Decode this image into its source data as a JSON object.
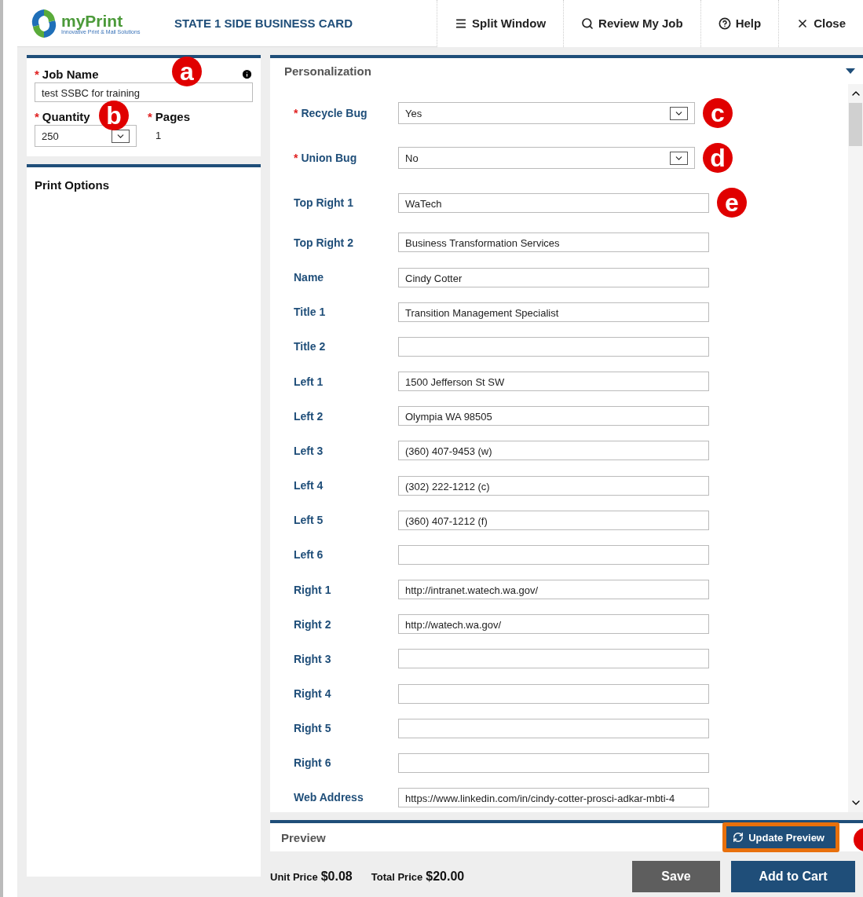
{
  "header": {
    "logo_text": "myPrint",
    "logo_tagline": "Innovative Print & Mail Solutions",
    "title": "STATE 1 SIDE BUSINESS CARD",
    "actions": [
      {
        "label": "Split Window"
      },
      {
        "label": "Review My Job"
      },
      {
        "label": "Help"
      },
      {
        "label": "Close"
      }
    ]
  },
  "job": {
    "job_name": {
      "label": "Job Name",
      "required_mark": "*",
      "value": "test SSBC for training",
      "marker": "a"
    },
    "quantity": {
      "label": "Quantity",
      "required_mark": "*",
      "value": "250",
      "marker": "b"
    },
    "pages": {
      "label": "Pages",
      "required_mark": "*",
      "value": "1"
    }
  },
  "print_options": {
    "title": "Print Options"
  },
  "personalization": {
    "title": "Personalization",
    "fields": [
      {
        "label": "Recycle Bug",
        "kind": "select",
        "required_mark": "*",
        "value": "Yes",
        "marker": "c"
      },
      {
        "label": "Union Bug",
        "kind": "select",
        "required_mark": "*",
        "value": "No",
        "marker": "d"
      },
      {
        "label": "Top Right 1",
        "kind": "text",
        "value": "WaTech",
        "marker": "e"
      },
      {
        "label": "Top Right 2",
        "kind": "text",
        "value": "Business Transformation Services"
      },
      {
        "label": "Name",
        "kind": "text",
        "value": "Cindy Cotter"
      },
      {
        "label": "Title 1",
        "kind": "text",
        "value": "Transition Management Specialist"
      },
      {
        "label": "Title 2",
        "kind": "text"
      },
      {
        "label": "Left 1",
        "kind": "text",
        "value": "1500 Jefferson St SW"
      },
      {
        "label": "Left 2",
        "kind": "text",
        "value": "Olympia WA 98505"
      },
      {
        "label": "Left 3",
        "kind": "text",
        "value": "(360) 407-9453 (w)"
      },
      {
        "label": "Left 4",
        "kind": "text",
        "value": "(302) 222-1212 (c)"
      },
      {
        "label": "Left 5",
        "kind": "text",
        "value": "(360) 407-1212 (f)"
      },
      {
        "label": "Left 6",
        "kind": "text"
      },
      {
        "label": "Right 1",
        "kind": "text",
        "value": "http://intranet.watech.wa.gov/"
      },
      {
        "label": "Right 2",
        "kind": "text",
        "value": "http://watech.wa.gov/"
      },
      {
        "label": "Right 3",
        "kind": "text"
      },
      {
        "label": "Right 4",
        "kind": "text"
      },
      {
        "label": "Right 5",
        "kind": "text"
      },
      {
        "label": "Right 6",
        "kind": "text"
      },
      {
        "label": "Web Address",
        "kind": "text",
        "value": "https://www.linkedin.com/in/cindy-cotter-prosci-adkar-mbti-4"
      }
    ]
  },
  "preview": {
    "title": "Preview",
    "update_button": "Update Preview",
    "highlighted": true
  },
  "footer": {
    "unit_price_label": "Unit Price",
    "unit_price": "$0.08",
    "total_price_label": "Total Price",
    "total_price": "$20.00",
    "buttons": [
      "Save",
      "Add to Cart"
    ]
  }
}
